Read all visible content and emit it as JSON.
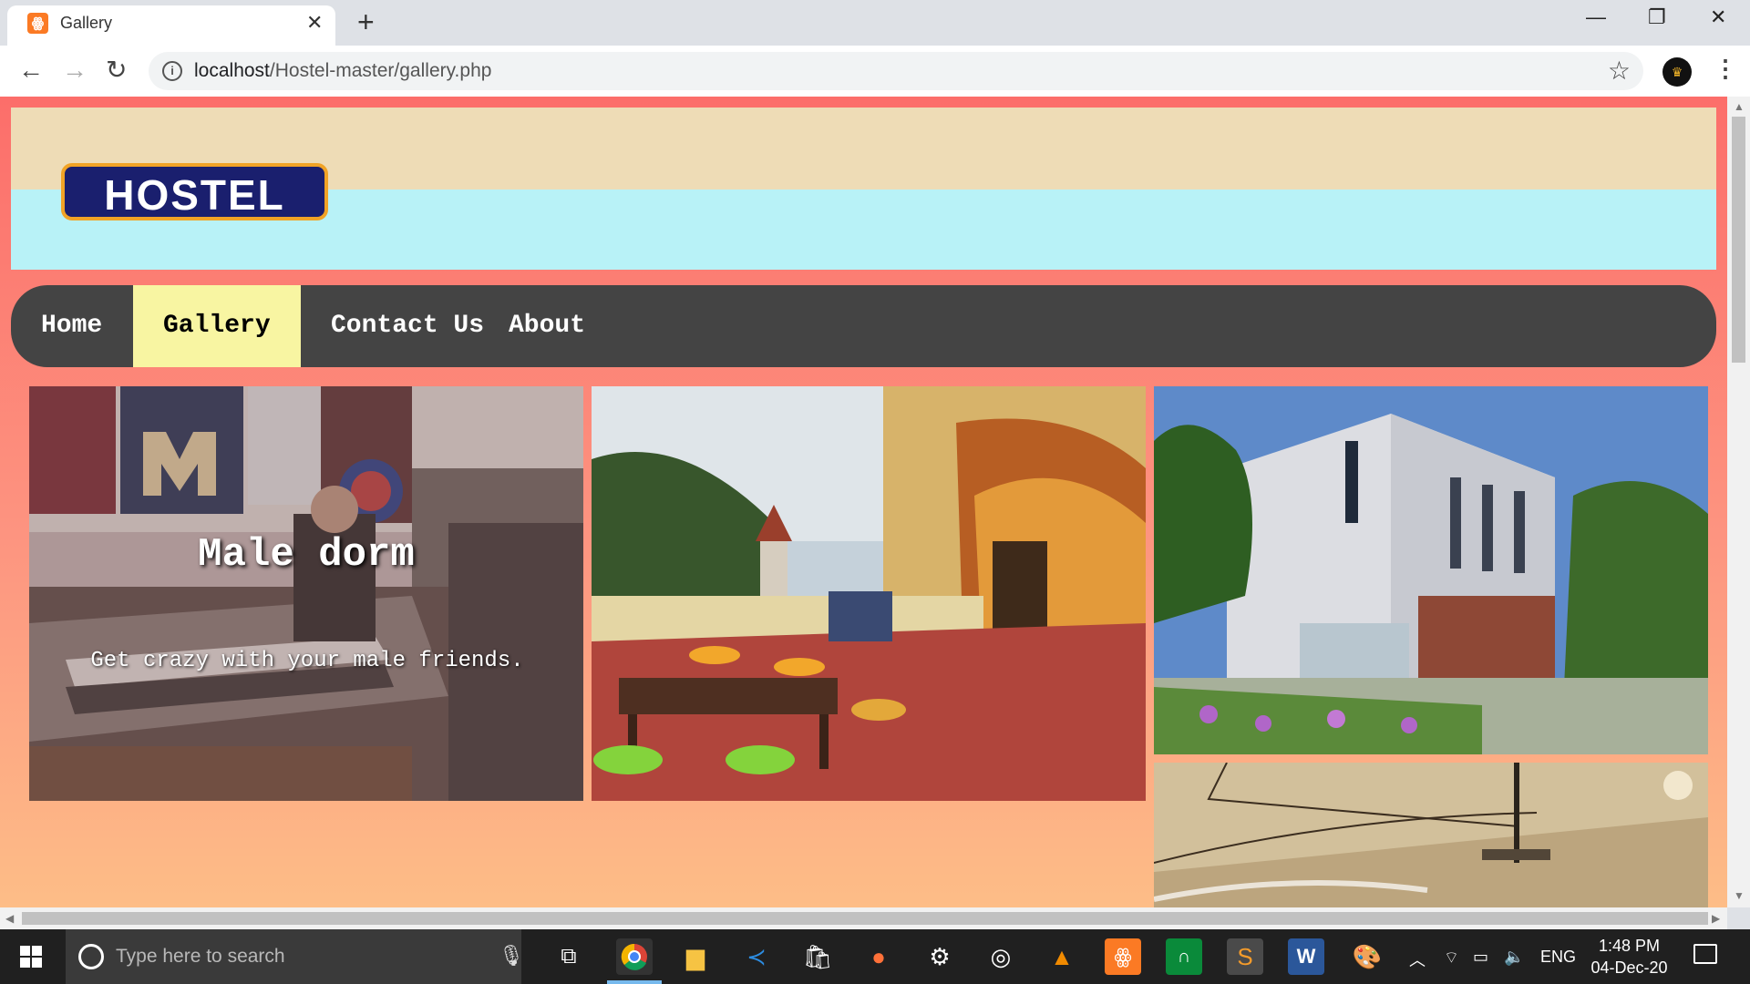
{
  "browser": {
    "tab_title": "Gallery",
    "tab_close": "✕",
    "new_tab": "+",
    "url_host": "localhost",
    "url_path": "/Hostel-master/gallery.php"
  },
  "site": {
    "logo_text": "HOSTEL",
    "menu": [
      {
        "label": "Home"
      },
      {
        "label": "Gallery"
      },
      {
        "label": "Contact Us"
      },
      {
        "label": "About"
      }
    ],
    "active_menu": "Gallery",
    "cards": [
      {
        "title": "Male dorm",
        "description": "Get crazy with your male friends."
      }
    ]
  },
  "taskbar": {
    "search_placeholder": "Type here to search",
    "language": "ENG",
    "time": "1:48 PM",
    "date": "04-Dec-20"
  },
  "colors": {
    "page_gradient_top": "#fc6e6a",
    "page_gradient_bottom": "#fdbd87",
    "menu_bg": "#444444",
    "menu_active": "#f8f5a2",
    "header_top": "#eedcb6",
    "header_bottom": "#b8f2f7"
  }
}
